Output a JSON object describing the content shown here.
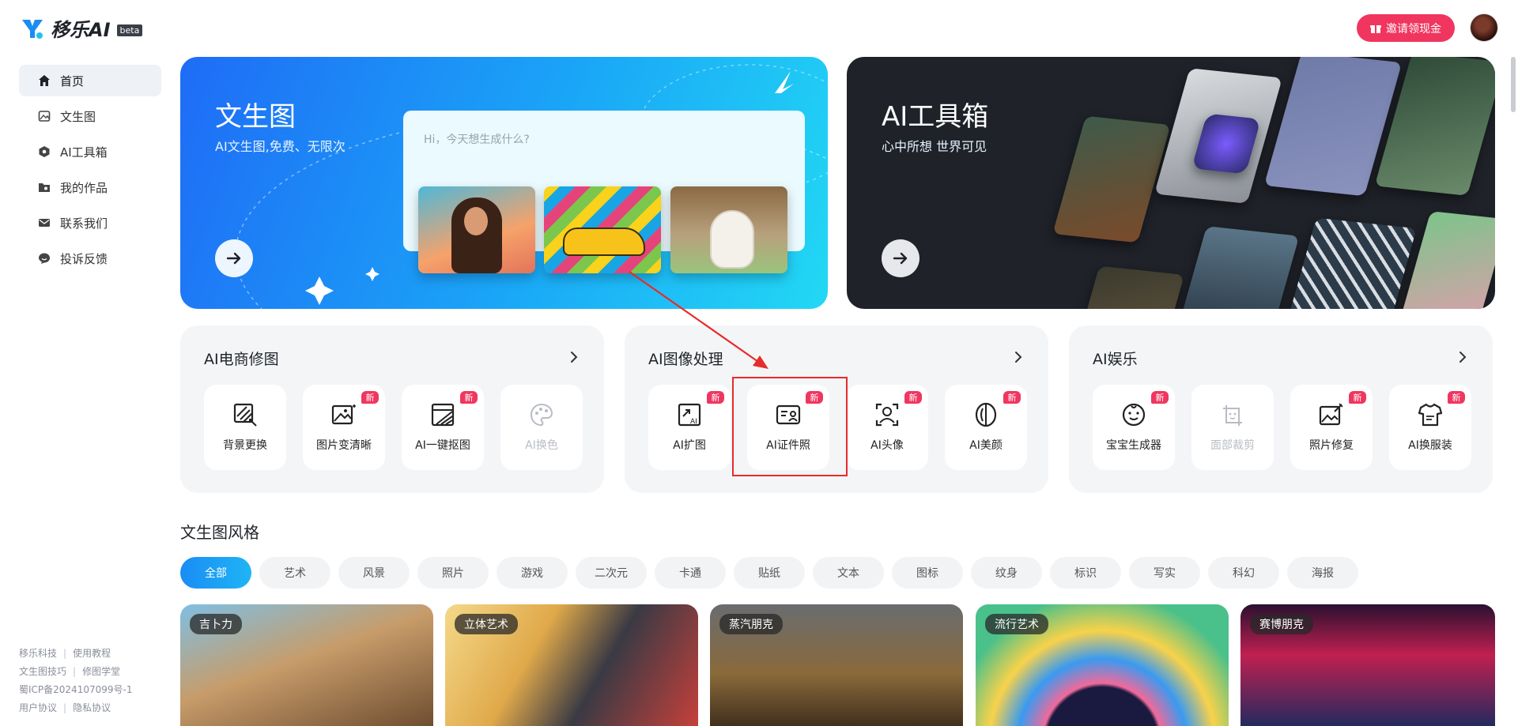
{
  "header": {
    "logo_text": "移乐AI",
    "logo_badge": "beta",
    "invite_label": "邀请领现金"
  },
  "sidebar": {
    "items": [
      {
        "label": "首页",
        "icon": "home-icon",
        "active": true
      },
      {
        "label": "文生图",
        "icon": "image-icon",
        "active": false
      },
      {
        "label": "AI工具箱",
        "icon": "cube-icon",
        "active": false
      },
      {
        "label": "我的作品",
        "icon": "folder-icon",
        "active": false
      },
      {
        "label": "联系我们",
        "icon": "mail-icon",
        "active": false
      },
      {
        "label": "投诉反馈",
        "icon": "chat-icon",
        "active": false
      }
    ],
    "footer": {
      "link1": "移乐科技",
      "link2": "使用教程",
      "link3": "文生图技巧",
      "link4": "修图学堂",
      "icp": "蜀ICP备2024107099号-1",
      "link5": "用户协议",
      "link6": "隐私协议"
    }
  },
  "banners": {
    "text2img": {
      "title": "文生图",
      "subtitle": "AI文生图,免费、无限次",
      "placeholder": "Hi，今天想生成什么?"
    },
    "toolbox": {
      "title": "AI工具箱",
      "subtitle": "心中所想 世界可见"
    }
  },
  "tool_groups": [
    {
      "title": "AI电商修图",
      "items": [
        {
          "label": "背景更换",
          "icon": "background-replace-icon",
          "badge": "",
          "disabled": false
        },
        {
          "label": "图片变清晰",
          "icon": "image-enhance-icon",
          "badge": "新",
          "disabled": false
        },
        {
          "label": "AI一键抠图",
          "icon": "cutout-icon",
          "badge": "新",
          "disabled": false
        },
        {
          "label": "AI换色",
          "icon": "palette-icon",
          "badge": "",
          "disabled": true
        }
      ]
    },
    {
      "title": "AI图像处理",
      "items": [
        {
          "label": "AI扩图",
          "icon": "expand-image-icon",
          "badge": "新",
          "disabled": false
        },
        {
          "label": "AI证件照",
          "icon": "id-photo-icon",
          "badge": "新",
          "disabled": false
        },
        {
          "label": "AI头像",
          "icon": "avatar-icon",
          "badge": "新",
          "disabled": false
        },
        {
          "label": "AI美颜",
          "icon": "beauty-icon",
          "badge": "新",
          "disabled": false
        }
      ]
    },
    {
      "title": "AI娱乐",
      "items": [
        {
          "label": "宝宝生成器",
          "icon": "baby-face-icon",
          "badge": "新",
          "disabled": false
        },
        {
          "label": "面部裁剪",
          "icon": "face-crop-icon",
          "badge": "",
          "disabled": true
        },
        {
          "label": "照片修复",
          "icon": "photo-repair-icon",
          "badge": "新",
          "disabled": false
        },
        {
          "label": "AI换服装",
          "icon": "clothes-icon",
          "badge": "新",
          "disabled": false
        }
      ]
    }
  ],
  "styles_section": {
    "title": "文生图风格",
    "chips": [
      "全部",
      "艺术",
      "风景",
      "照片",
      "游戏",
      "二次元",
      "卡通",
      "贴纸",
      "文本",
      "图标",
      "纹身",
      "标识",
      "写实",
      "科幻",
      "海报"
    ],
    "active_chip": 0,
    "cards": [
      {
        "tag": "吉卜力"
      },
      {
        "tag": "立体艺术"
      },
      {
        "tag": "蒸汽朋克"
      },
      {
        "tag": "流行艺术"
      },
      {
        "tag": "赛博朋克"
      }
    ]
  },
  "colors": {
    "accent_blue": "#1a8cf5",
    "badge_red": "#f0365f",
    "highlight_red": "#e82b2b",
    "dark_banner": "#1f2229"
  }
}
